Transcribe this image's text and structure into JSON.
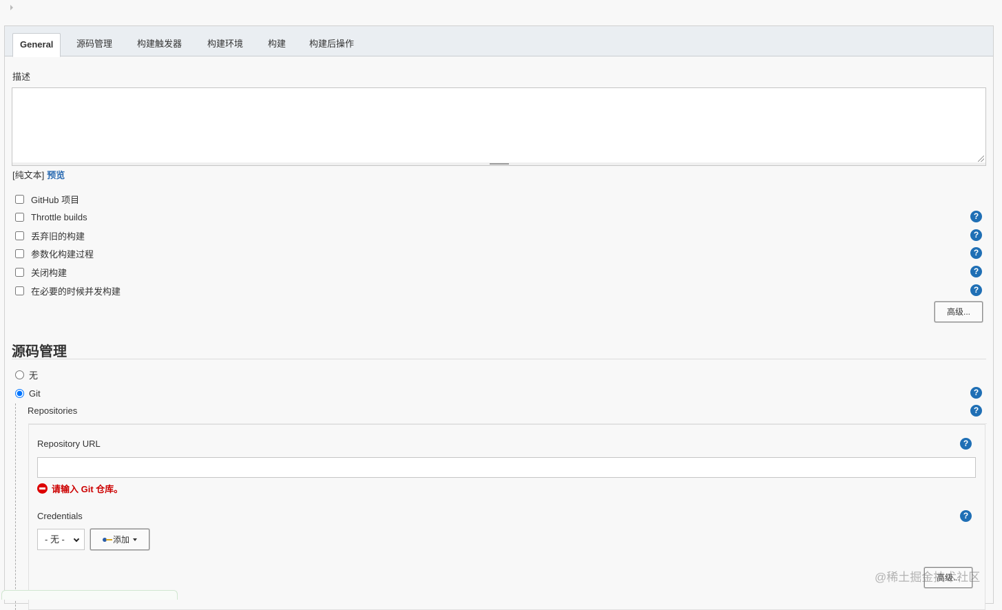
{
  "tabs": [
    "General",
    "源码管理",
    "构建触发器",
    "构建环境",
    "构建",
    "构建后操作"
  ],
  "general": {
    "description_label": "描述",
    "description_value": "",
    "format_label": "[纯文本]",
    "preview_link": "预览",
    "options": [
      {
        "label": "GitHub 项目",
        "checked": false,
        "help": false
      },
      {
        "label": "Throttle builds",
        "checked": false,
        "help": true
      },
      {
        "label": "丢弃旧的构建",
        "checked": false,
        "help": true
      },
      {
        "label": "参数化构建过程",
        "checked": false,
        "help": true
      },
      {
        "label": "关闭构建",
        "checked": false,
        "help": true
      },
      {
        "label": "在必要的时候并发构建",
        "checked": false,
        "help": true
      }
    ],
    "advanced_button": "高级..."
  },
  "scm": {
    "title": "源码管理",
    "options": [
      {
        "label": "无",
        "selected": false
      },
      {
        "label": "Git",
        "selected": true
      }
    ],
    "repositories_label": "Repositories",
    "repository_url_label": "Repository URL",
    "repository_url_value": "",
    "error_message": "请输入 Git 仓库。",
    "credentials_label": "Credentials",
    "credentials_selected": "- 无 -",
    "add_button": "添加",
    "advanced_button": "高级..."
  },
  "help_glyph": "?",
  "watermark": "@稀土掘金技术社区",
  "colors": {
    "accent": "#1f6fb5",
    "error": "#cc0000",
    "link": "#2c6cb3"
  }
}
